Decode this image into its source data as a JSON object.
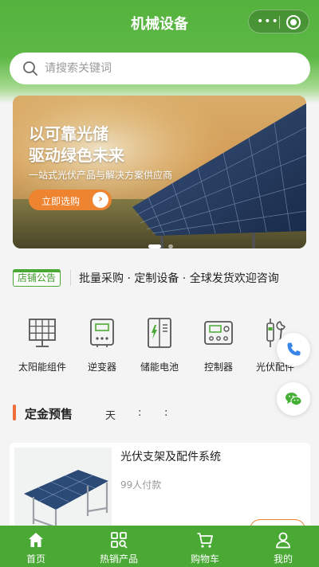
{
  "header": {
    "title": "机械设备"
  },
  "search": {
    "placeholder": "请搜索关键词"
  },
  "banner": {
    "title_line1": "以可靠光储",
    "title_line2": "驱动绿色未来",
    "subtitle": "一站式光伏产品与解决方案供应商",
    "button_label": "立即选购",
    "button_arrow": "›",
    "slide_count": 2,
    "active_slide": 1
  },
  "notice": {
    "badge": "店铺公告",
    "text": "批量采购 · 定制设备 · 全球发货欢迎咨询"
  },
  "categories": [
    {
      "label": "太阳能组件",
      "icon": "solar-panel-icon"
    },
    {
      "label": "逆变器",
      "icon": "inverter-icon"
    },
    {
      "label": "储能电池",
      "icon": "battery-cabinet-icon"
    },
    {
      "label": "控制器",
      "icon": "controller-icon"
    },
    {
      "label": "光伏配件",
      "icon": "connector-wrench-icon"
    }
  ],
  "floating": {
    "phone_icon": "phone-icon",
    "wechat_icon": "wechat-icon"
  },
  "presale": {
    "title": "定金预售",
    "day_unit": "天",
    "sep1": ":",
    "sep2": ":"
  },
  "product": {
    "name": "光伏支架及配件系统",
    "sales": "99人付款"
  },
  "tabbar": [
    {
      "label": "首页",
      "icon": "home-icon"
    },
    {
      "label": "热销产品",
      "icon": "grid-search-icon"
    },
    {
      "label": "购物车",
      "icon": "cart-icon"
    },
    {
      "label": "我的",
      "icon": "user-icon"
    }
  ],
  "colors": {
    "brand_green": "#4aa935",
    "accent_orange": "#ee8330",
    "section_bar": "#ee6f3a",
    "phone_blue": "#3a86e8",
    "wechat_green": "#45b035"
  }
}
